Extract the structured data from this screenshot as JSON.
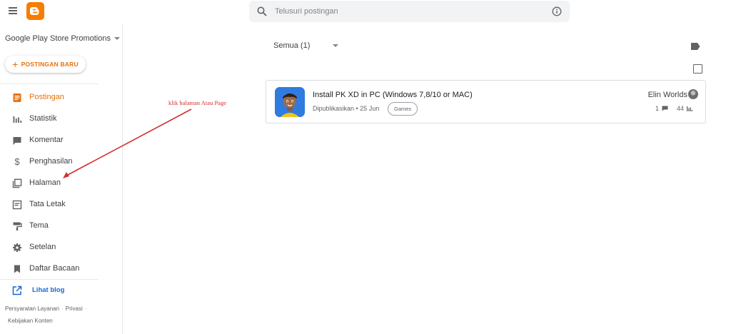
{
  "topbar": {
    "search_placeholder": "Telusuri postingan"
  },
  "sidebar": {
    "blog_name": "Google Play Store Promotions",
    "new_post_label": "POSTINGAN BARU",
    "items": [
      {
        "label": "Postingan",
        "icon": "posts-icon",
        "active": true
      },
      {
        "label": "Statistik",
        "icon": "stats-icon"
      },
      {
        "label": "Komentar",
        "icon": "comment-icon"
      },
      {
        "label": "Penghasilan",
        "icon": "dollar-icon"
      },
      {
        "label": "Halaman",
        "icon": "pages-icon"
      },
      {
        "label": "Tata Letak",
        "icon": "layout-icon"
      },
      {
        "label": "Tema",
        "icon": "paint-roller-icon"
      },
      {
        "label": "Setelan",
        "icon": "gear-icon"
      },
      {
        "label": "Daftar Bacaan",
        "icon": "bookmark-icon"
      }
    ],
    "view_blog_label": "Lihat blog",
    "footer": {
      "terms": "Persyaratan Layanan",
      "privacy": "Privasi",
      "content_policy": "Kebijakan Konten"
    }
  },
  "main": {
    "filter_label": "Semua (1)",
    "posts": [
      {
        "title": "Install PK XD in PC (Windows 7,8/10 or MAC)",
        "status": "Dipublikasikan • 25 Jun",
        "label": "Games",
        "author": "Elin Worlds",
        "comments": "1",
        "views": "44"
      }
    ]
  },
  "annotation": {
    "text": "klik halaman Atau Page"
  },
  "colors": {
    "accent": "#e8710a",
    "logo": "#f57d00",
    "annotation": "#d32f2f",
    "link": "#1967d2"
  }
}
